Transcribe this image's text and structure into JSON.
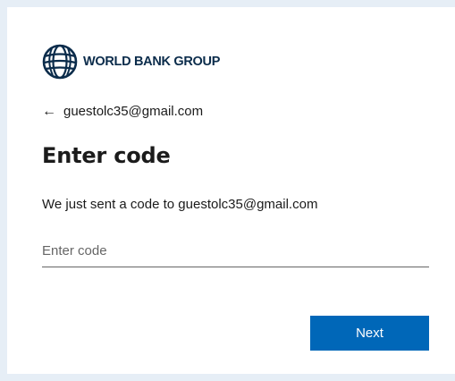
{
  "brand": {
    "logo_text": "WORLD BANK GROUP",
    "logo_icon": "globe-icon",
    "color": "#0b2c4b"
  },
  "identity": {
    "back_icon": "arrow-left-icon",
    "back_glyph": "←",
    "email": "guestolc35@gmail.com"
  },
  "page": {
    "title": "Enter code",
    "description": "We just sent a code to guestolc35@gmail.com"
  },
  "form": {
    "code_placeholder": "Enter code",
    "code_value": ""
  },
  "actions": {
    "next_label": "Next",
    "accent": "#0067b8"
  }
}
